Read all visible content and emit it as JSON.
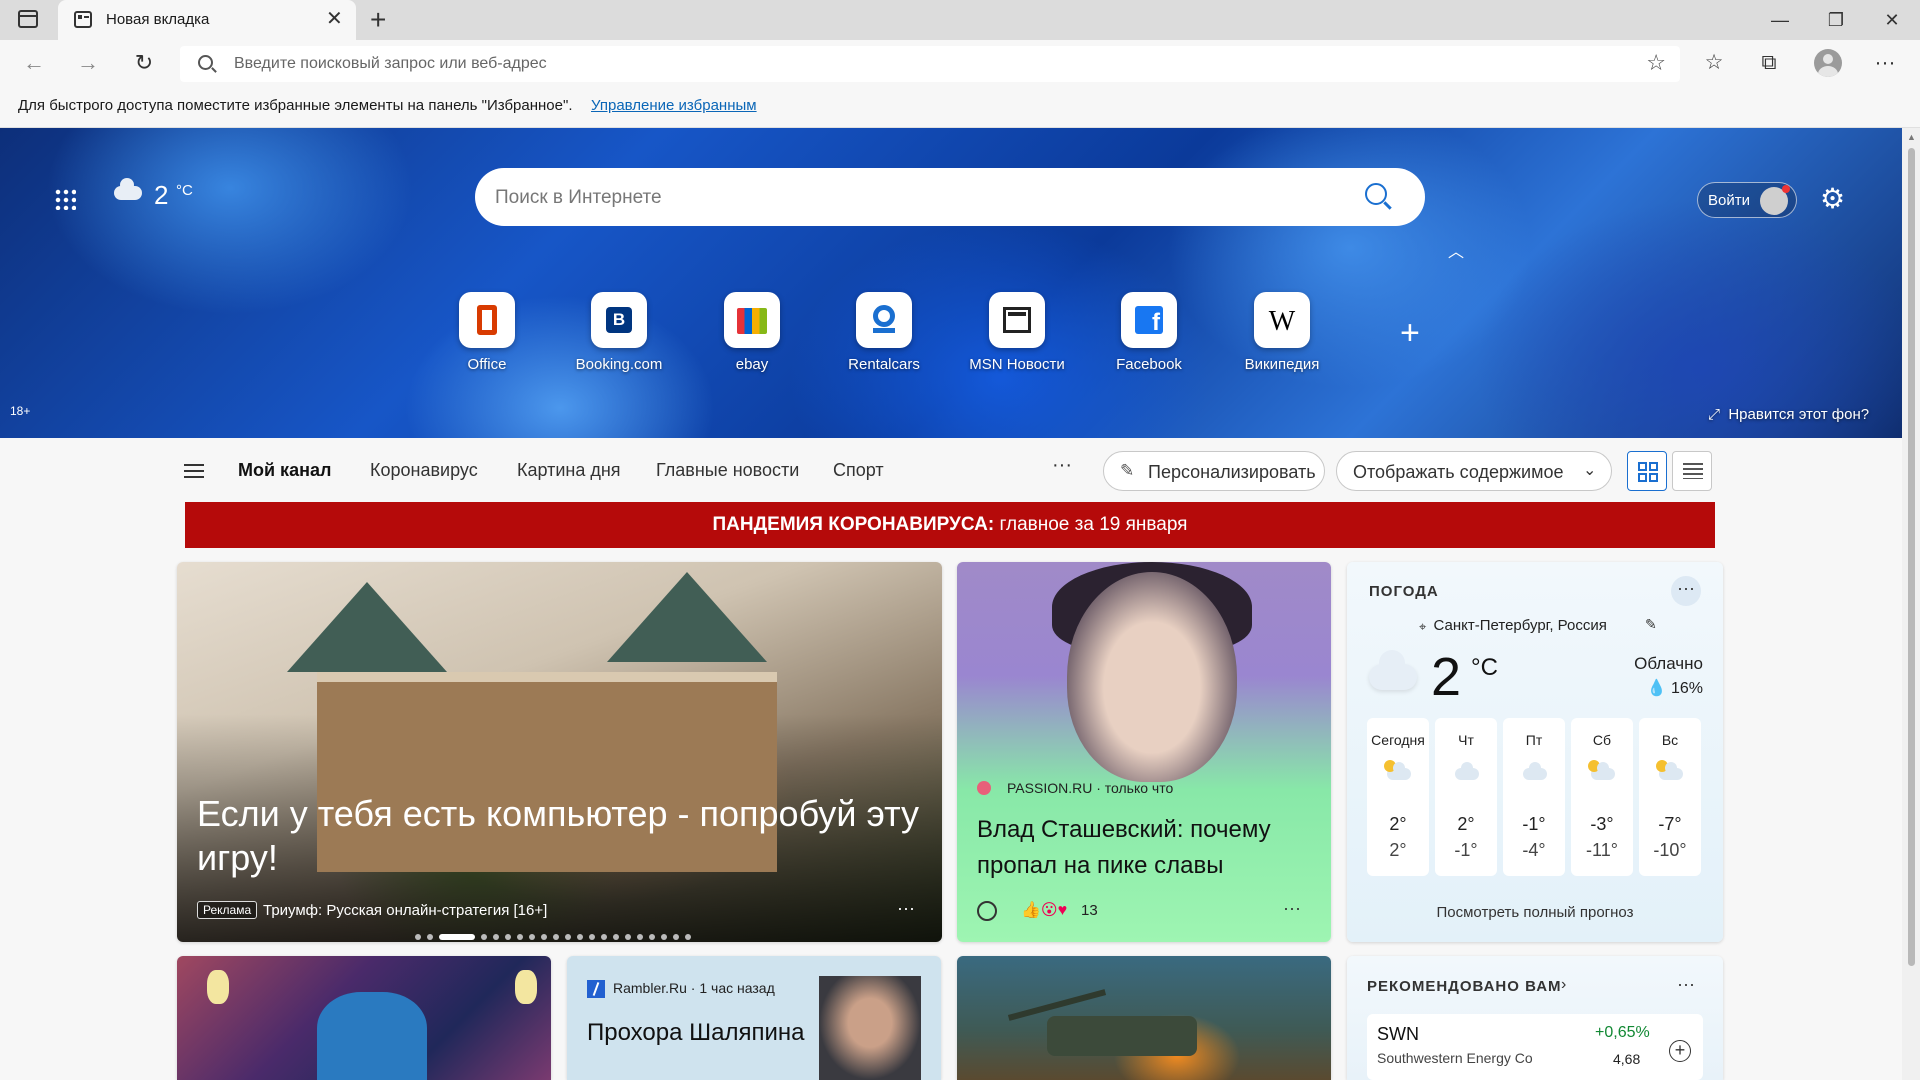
{
  "browser": {
    "tab_title": "Новая вкладка",
    "address_placeholder": "Введите поисковый запрос или веб-адрес",
    "favorites_hint": "Для быстрого доступа поместите избранные элементы на панель \"Избранное\".",
    "favorites_link": "Управление избранным"
  },
  "hero": {
    "temperature": "2",
    "unit": "°C",
    "search_placeholder": "Поиск в Интернете",
    "signin_label": "Войти",
    "age_rating": "18+",
    "like_background": "Нравится этот фон?",
    "quick_links": [
      {
        "label": "Office",
        "icon": "office-icon",
        "color": "#d83b01"
      },
      {
        "label": "Booking.com",
        "icon": "booking-icon",
        "color": "#003580"
      },
      {
        "label": "ebay",
        "icon": "ebay-icon",
        "color": "#e53238"
      },
      {
        "label": "Rentalcars",
        "icon": "rentalcars-icon",
        "color": "#1a6fd0"
      },
      {
        "label": "MSN Новости",
        "icon": "msn-news-icon",
        "color": "#222222"
      },
      {
        "label": "Facebook",
        "icon": "facebook-icon",
        "color": "#1877f2"
      },
      {
        "label": "Википедия",
        "icon": "wikipedia-icon",
        "color": "#000000"
      }
    ]
  },
  "feed_nav": {
    "tabs": [
      "Мой канал",
      "Коронавирус",
      "Картина дня",
      "Главные новости",
      "Спорт"
    ],
    "more": "···",
    "personalize": "Персонализировать",
    "display_content": "Отображать содержимое"
  },
  "banner": {
    "bold": "ПАНДЕМИЯ КОРОНАВИРУСА:",
    "text": " главное за 19 января",
    "color": "#b50a0a"
  },
  "cards": {
    "ad": {
      "title": "Если у тебя есть компьютер - попробуй эту игру!",
      "badge": "Реклама",
      "text": "Триумф: Русская онлайн-стратегия [16+]",
      "more": "···"
    },
    "news1": {
      "source": "PASSION.RU · только что",
      "title": "Влад Сташевский: почему пропал на пике славы",
      "reactions": "13",
      "more": "···"
    },
    "news2": {
      "source": "Rambler.Ru · 1 час назад",
      "title": "Прохора Шаляпина"
    }
  },
  "weather": {
    "heading": "ПОГОДА",
    "more": "···",
    "location": "Санкт-Петербург, Россия",
    "temperature": "2",
    "unit": "°C",
    "condition": "Облачно",
    "humidity": "16%",
    "days": [
      {
        "name": "Сегодня",
        "hi": "2°",
        "lo": "2°",
        "icon": "partly-sunny-icon"
      },
      {
        "name": "Чт",
        "hi": "2°",
        "lo": "-1°",
        "icon": "snow-cloud-icon"
      },
      {
        "name": "Пт",
        "hi": "-1°",
        "lo": "-4°",
        "icon": "cloud-icon"
      },
      {
        "name": "Сб",
        "hi": "-3°",
        "lo": "-11°",
        "icon": "sun-snow-icon"
      },
      {
        "name": "Вс",
        "hi": "-7°",
        "lo": "-10°",
        "icon": "partly-sunny-icon"
      }
    ],
    "full_forecast": "Посмотреть полный прогноз"
  },
  "recommended": {
    "heading": "РЕКОМЕНДОВАНО ВАМ",
    "more": "···",
    "stock": {
      "symbol": "SWN",
      "name": "Southwestern Energy Co",
      "change": "+0,65%",
      "price": "4,68"
    }
  }
}
